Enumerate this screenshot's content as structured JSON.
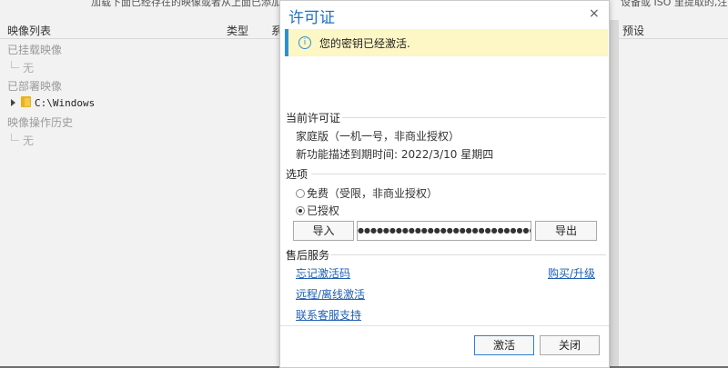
{
  "background": {
    "top_hint_left": "加载下面已经存在的映像或者从上面已添加一",
    "top_hint_right": "设备或 ISO 里提取的,注意来源",
    "columns": [
      "映像列表",
      "类型",
      "系",
      "预设"
    ],
    "tree": {
      "mounted_label": "已挂载映像",
      "mounted_child": "无",
      "deployed_label": "已部署映像",
      "deployed_child": "C:\\Windows",
      "history_label": "映像操作历史",
      "history_child": "无"
    }
  },
  "dialog": {
    "title": "许可证",
    "close_glyph": "×",
    "notice": "您的密钥已经激活.",
    "current_license_heading": "当前许可证",
    "edition": "家庭版（一机一号，非商业授权）",
    "expiry": "新功能描述到期时间: 2022/3/10 星期四",
    "options_heading": "选项",
    "option_free": "免费（受限，非商业授权）",
    "option_licensed": "已授权",
    "import_label": "导入",
    "key_masked": "●●●●●●●●●●●●●●●●●●●●●●●●●●●●●●●",
    "export_label": "导出",
    "after_sales_heading": "售后服务",
    "forgot_code": "忘记激活码",
    "buy_upgrade": "购买/升级",
    "remote_activation": "远程/离线激活",
    "contact_support": "联系客服支持",
    "activate_label": "激活",
    "close_label": "关闭"
  },
  "colors": {
    "accent": "#1a73c9",
    "notice_bg": "#fdf6c5",
    "notice_bar": "#2d8fd6",
    "link": "#1f5fb3"
  }
}
